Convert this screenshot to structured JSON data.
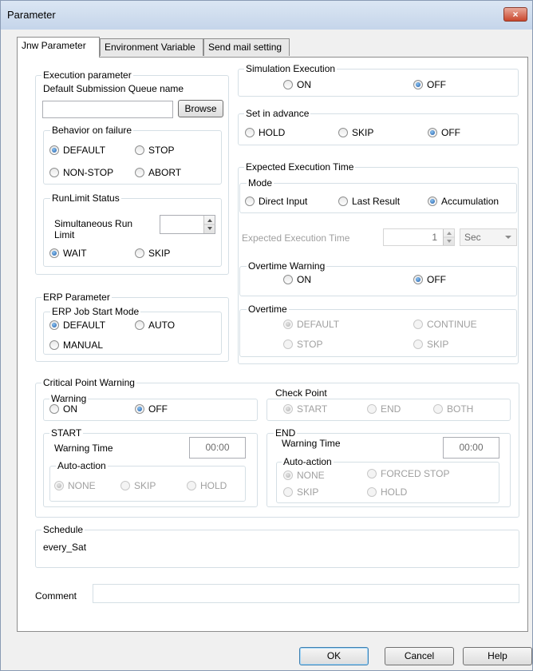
{
  "window": {
    "title": "Parameter",
    "close_glyph": "×"
  },
  "tabs": [
    {
      "label": "Jnw Parameter",
      "active": true
    },
    {
      "label": "Environment Variable",
      "active": false
    },
    {
      "label": "Send mail setting",
      "active": false
    }
  ],
  "execution_parameter": {
    "title": "Execution parameter",
    "queue_label": "Default Submission Queue name",
    "queue_value": "",
    "browse_label": "Browse"
  },
  "behavior_on_failure": {
    "title": "Behavior on failure",
    "options": [
      "DEFAULT",
      "STOP",
      "NON-STOP",
      "ABORT"
    ],
    "selected": "DEFAULT"
  },
  "runlimit_status": {
    "title": "RunLimit Status",
    "sim_run_label_1": "Simultaneous Run",
    "sim_run_label_2": "Limit",
    "sim_run_value": "",
    "options": [
      "WAIT",
      "SKIP"
    ],
    "selected": "WAIT"
  },
  "erp_parameter": {
    "title": "ERP Parameter",
    "start_mode_title": "ERP Job Start Mode",
    "options": [
      "DEFAULT",
      "AUTO",
      "MANUAL"
    ],
    "selected": "DEFAULT"
  },
  "simulation_execution": {
    "title": "Simulation Execution",
    "options": [
      "ON",
      "OFF"
    ],
    "selected": "OFF"
  },
  "set_in_advance": {
    "title": "Set in advance",
    "options": [
      "HOLD",
      "SKIP",
      "OFF"
    ],
    "selected": "OFF"
  },
  "expected_execution_time": {
    "title": "Expected Execution Time",
    "mode_title": "Mode",
    "mode_options": [
      "Direct Input",
      "Last Result",
      "Accumulation"
    ],
    "mode_selected": "Accumulation",
    "time_label": "Expected Execution Time",
    "time_value": "1",
    "unit_value": "Sec",
    "overtime_warning_title": "Overtime Warning",
    "overtime_warning_options": [
      "ON",
      "OFF"
    ],
    "overtime_warning_selected": "OFF",
    "overtime_title": "Overtime",
    "overtime_options": [
      "DEFAULT",
      "CONTINUE",
      "STOP",
      "SKIP"
    ],
    "overtime_selected": "DEFAULT"
  },
  "critical_point_warning": {
    "title": "Critical Point Warning",
    "warning_title": "Warning",
    "warning_options": [
      "ON",
      "OFF"
    ],
    "warning_selected": "OFF",
    "check_point_title": "Check Point",
    "check_point_options": [
      "START",
      "END",
      "BOTH"
    ],
    "check_point_selected": "START",
    "start": {
      "title": "START",
      "warning_time_label": "Warning Time",
      "warning_time_value": "00:00",
      "auto_action_title": "Auto-action",
      "options": [
        "NONE",
        "SKIP",
        "HOLD"
      ],
      "selected": "NONE"
    },
    "end": {
      "title": "END",
      "warning_time_label": "Warning Time",
      "warning_time_value": "00:00",
      "auto_action_title": "Auto-action",
      "options": [
        "NONE",
        "FORCED STOP",
        "SKIP",
        "HOLD"
      ],
      "selected": "NONE"
    }
  },
  "schedule": {
    "title": "Schedule",
    "value": "every_Sat"
  },
  "comment": {
    "label": "Comment",
    "value": ""
  },
  "buttons": {
    "ok": "OK",
    "cancel": "Cancel",
    "help": "Help"
  }
}
